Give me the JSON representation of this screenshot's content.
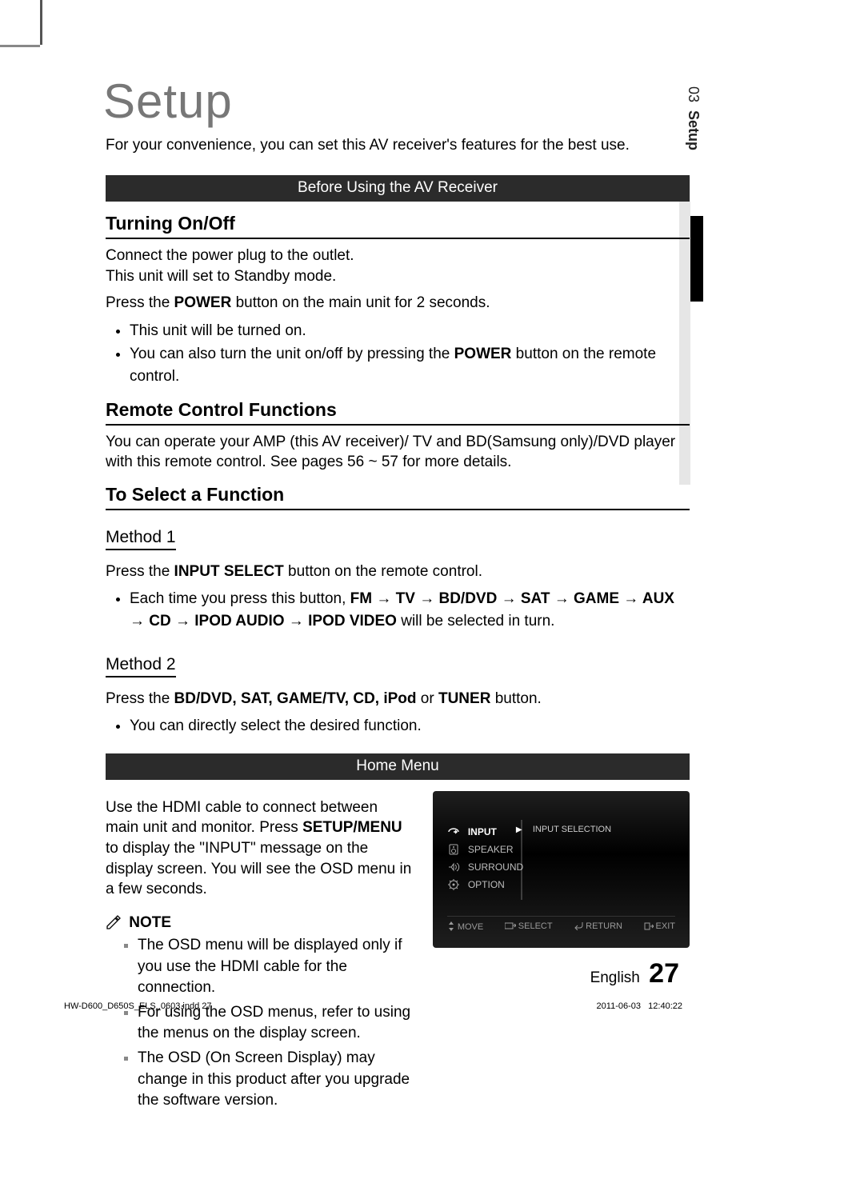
{
  "side": {
    "chapter_num": "03",
    "chapter_label": "Setup"
  },
  "title": "Setup",
  "intro": "For your convenience, you can set this AV receiver's features for the best use.",
  "banner1": "Before Using the AV Receiver",
  "s1": {
    "heading": "Turning On/Off",
    "p1a": "Connect the power plug to the outlet.",
    "p1b": "This unit will set to Standby mode.",
    "p2_pre": "Press the ",
    "p2_bold": "POWER",
    "p2_post": " button on the main unit for 2 seconds.",
    "b1": "This unit will be turned on.",
    "b2_pre": "You can also turn the unit on/off by pressing the ",
    "b2_bold": "POWER",
    "b2_post": " button on the remote control."
  },
  "s2": {
    "heading": "Remote Control Functions",
    "p1": "You can operate your AMP (this AV receiver)/ TV and BD(Samsung only)/DVD player with this remote control.  See pages 56 ~ 57 for more details."
  },
  "s3": {
    "heading": "To Select a Function",
    "m1": {
      "label": "Method 1",
      "p_pre": "Press the ",
      "p_bold": "INPUT SELECT",
      "p_post": " button on the remote control.",
      "b1_pre": "Each time you press this button, ",
      "seq": "FM → TV → BD/DVD → SAT → GAME → AUX → CD → IPOD AUDIO → IPOD VIDEO",
      "b1_post": " will be selected in turn."
    },
    "m2": {
      "label": "Method 2",
      "p_pre": "Press the ",
      "p_bold": "BD/DVD, SAT, GAME/TV, CD, iPod",
      "p_mid": " or ",
      "p_bold2": "TUNER",
      "p_post": " button.",
      "b1": "You can directly select the desired function."
    }
  },
  "banner2": "Home Menu",
  "home": {
    "p_pre": "Use the HDMI cable to connect between main unit and monitor. Press ",
    "p_bold": "SETUP/MENU",
    "p_post": " to display the \"INPUT\" message on the display screen. You will see the OSD menu in a few seconds.",
    "note_label": "NOTE",
    "n1": "The OSD menu will be displayed only if you use the HDMI cable for the connection.",
    "n2": "For using the OSD menus, refer to using the menus on the display screen.",
    "n3": "The OSD (On Screen Display) may change in this product after you upgrade the software version."
  },
  "osd": {
    "items": [
      "INPUT",
      "SPEAKER",
      "SURROUND",
      "OPTION"
    ],
    "right_label": "INPUT SELECTION",
    "footer": {
      "move": "MOVE",
      "select": "SELECT",
      "return": "RETURN",
      "exit": "EXIT"
    }
  },
  "footer": {
    "lang": "English",
    "page": "27",
    "imprint_file": "HW-D600_D650S_ELS_0603.indd   27",
    "imprint_date": "2011-06-03",
    "imprint_time": "12:40:22"
  }
}
